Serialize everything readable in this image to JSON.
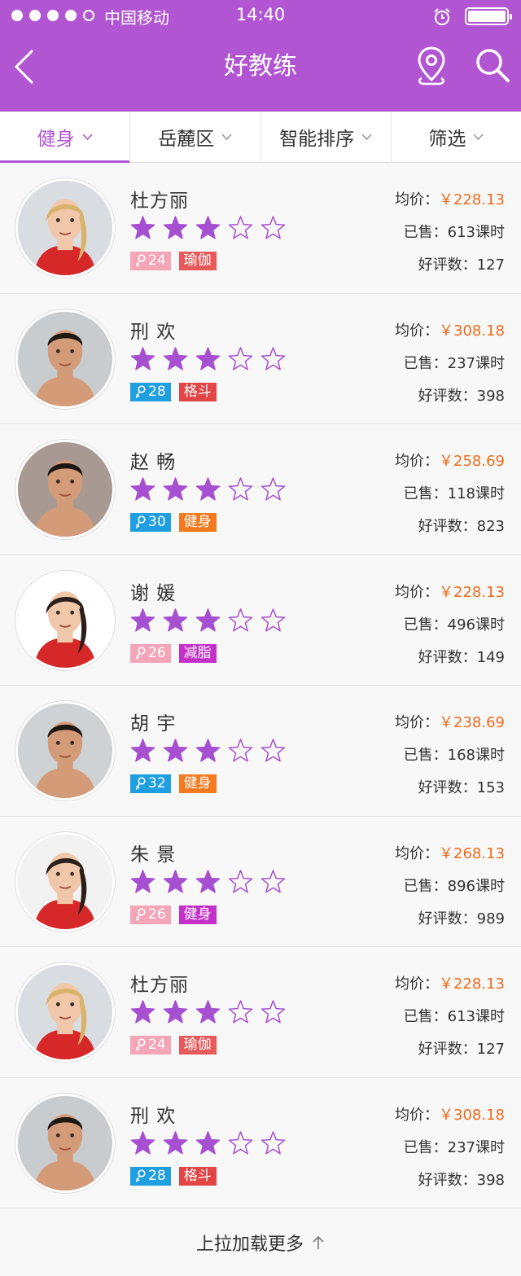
{
  "status_bar": {
    "carrier": "中国移动",
    "time": "14:40"
  },
  "header": {
    "title": "好教练",
    "back_icon": "chevron-left-icon",
    "location_icon": "location-pin-icon",
    "search_icon": "search-icon"
  },
  "filters": [
    {
      "label": "健身",
      "active": true
    },
    {
      "label": "岳麓区",
      "active": false
    },
    {
      "label": "智能排序",
      "active": false
    },
    {
      "label": "筛选",
      "active": false
    }
  ],
  "labels": {
    "avg_price": "均价：",
    "sold": "已售：",
    "reviews": "好评数：",
    "currency": "￥",
    "sold_unit": "课时"
  },
  "colors": {
    "accent": "#b255d2",
    "price": "#ef6b1a",
    "female_badge": "#f4a5b8",
    "male_badge": "#1f9fe0"
  },
  "coaches": [
    {
      "name": "杜方丽",
      "rating": 3,
      "gender": "female",
      "age": "24",
      "tag": "瑜伽",
      "tag_color": "#e85a5a",
      "price": "228.13",
      "sold": "613",
      "reviews": "127"
    },
    {
      "name": "刑 欢",
      "rating": 3,
      "gender": "male",
      "age": "28",
      "tag": "格斗",
      "tag_color": "#e14545",
      "price": "308.18",
      "sold": "237",
      "reviews": "398"
    },
    {
      "name": "赵 畅",
      "rating": 3,
      "gender": "male",
      "age": "30",
      "tag": "健身",
      "tag_color": "#f47a1f",
      "price": "258.69",
      "sold": "118",
      "reviews": "823"
    },
    {
      "name": "谢 媛",
      "rating": 3,
      "gender": "female",
      "age": "26",
      "tag": "减脂",
      "tag_color": "#c431c9",
      "price": "228.13",
      "sold": "496",
      "reviews": "149"
    },
    {
      "name": "胡 宇",
      "rating": 3,
      "gender": "male",
      "age": "32",
      "tag": "健身",
      "tag_color": "#f47a1f",
      "price": "238.69",
      "sold": "168",
      "reviews": "153"
    },
    {
      "name": "朱 景",
      "rating": 3,
      "gender": "female",
      "age": "26",
      "tag": "健身",
      "tag_color": "#c431c9",
      "price": "268.13",
      "sold": "896",
      "reviews": "989"
    },
    {
      "name": "杜方丽",
      "rating": 3,
      "gender": "female",
      "age": "24",
      "tag": "瑜伽",
      "tag_color": "#e85a5a",
      "price": "228.13",
      "sold": "613",
      "reviews": "127"
    },
    {
      "name": "刑 欢",
      "rating": 3,
      "gender": "male",
      "age": "28",
      "tag": "格斗",
      "tag_color": "#e14545",
      "price": "308.18",
      "sold": "237",
      "reviews": "398"
    }
  ],
  "load_more": {
    "label": "上拉加载更多",
    "icon": "arrow-up-icon"
  }
}
